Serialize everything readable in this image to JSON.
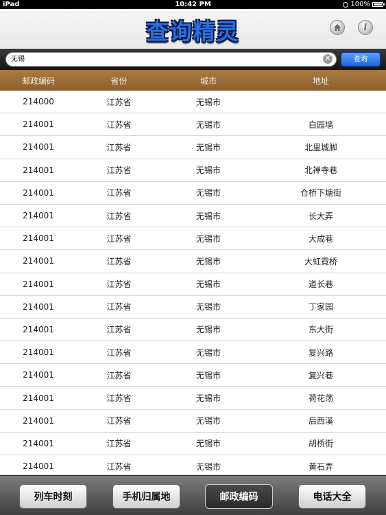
{
  "status_bar": {
    "device": "iPad",
    "time": "10:42 PM",
    "battery": "100%"
  },
  "header": {
    "title": "查询精灵",
    "title_color": "#2a6fe0",
    "home_icon": "home-icon",
    "info_icon": "info-icon",
    "info_glyph": "i"
  },
  "search": {
    "value": "无锡",
    "clear_glyph": "✕",
    "button_label": "查询",
    "accent": "#1f66e0"
  },
  "table": {
    "columns": [
      "邮政编码",
      "省份",
      "城市",
      "地址"
    ],
    "header_color": "#9a6b36",
    "rows": [
      [
        "214000",
        "江苏省",
        "无锡市",
        ""
      ],
      [
        "214001",
        "江苏省",
        "无锡市",
        "白园墙"
      ],
      [
        "214001",
        "江苏省",
        "无锡市",
        "北里城脚"
      ],
      [
        "214001",
        "江苏省",
        "无锡市",
        "北禅寺巷"
      ],
      [
        "214001",
        "江苏省",
        "无锡市",
        "仓桥下塘街"
      ],
      [
        "214001",
        "江苏省",
        "无锡市",
        "长大弄"
      ],
      [
        "214001",
        "江苏省",
        "无锡市",
        "大成巷"
      ],
      [
        "214001",
        "江苏省",
        "无锡市",
        "大虹霓桥"
      ],
      [
        "214001",
        "江苏省",
        "无锡市",
        "道长巷"
      ],
      [
        "214001",
        "江苏省",
        "无锡市",
        "丁家园"
      ],
      [
        "214001",
        "江苏省",
        "无锡市",
        "东大街"
      ],
      [
        "214001",
        "江苏省",
        "无锡市",
        "复兴路"
      ],
      [
        "214001",
        "江苏省",
        "无锡市",
        "复兴巷"
      ],
      [
        "214001",
        "江苏省",
        "无锡市",
        "荷花荡"
      ],
      [
        "214001",
        "江苏省",
        "无锡市",
        "后西溪"
      ],
      [
        "214001",
        "江苏省",
        "无锡市",
        "胡桥街"
      ],
      [
        "214001",
        "江苏省",
        "无锡市",
        "黄石弄"
      ]
    ]
  },
  "toolbar": {
    "items": [
      "列车时刻",
      "手机归属地",
      "邮政编码",
      "电话大全"
    ],
    "selected": "邮政编码"
  }
}
